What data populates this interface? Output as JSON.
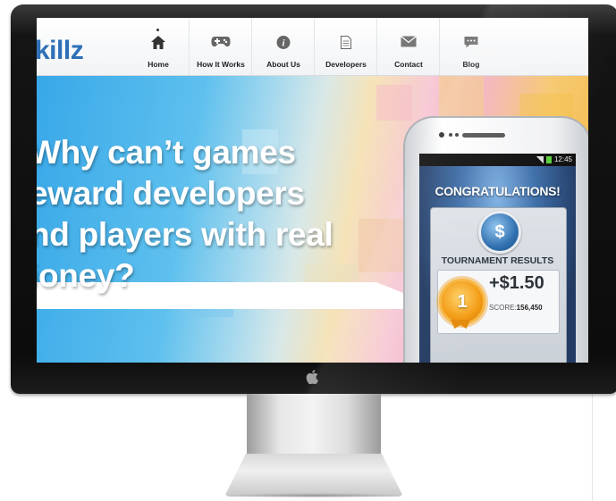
{
  "site": {
    "logo_text": "killz",
    "nav": [
      {
        "label": "Home",
        "icon": "home-icon"
      },
      {
        "label": "How It Works",
        "icon": "gamepad-icon"
      },
      {
        "label": "About Us",
        "icon": "info-icon"
      },
      {
        "label": "Developers",
        "icon": "document-icon"
      },
      {
        "label": "Contact",
        "icon": "envelope-icon"
      },
      {
        "label": "Blog",
        "icon": "speech-bubble-icon"
      }
    ]
  },
  "hero": {
    "headline_lines": [
      "Why can’t games",
      "eward developers",
      "nd players with real",
      "ioney?"
    ]
  },
  "phone": {
    "status_time": "12:45",
    "congrats": "CONGRATULATIONS!",
    "coin_symbol": "$",
    "tournament_title": "TOURNAMENT RESULTS",
    "amount": "+$1.50",
    "score_label": "SCORE:",
    "score_value": "156,450",
    "medal_rank": "1"
  },
  "colors": {
    "brand_blue": "#2e6fb6",
    "medal_orange": "#f39a12"
  }
}
